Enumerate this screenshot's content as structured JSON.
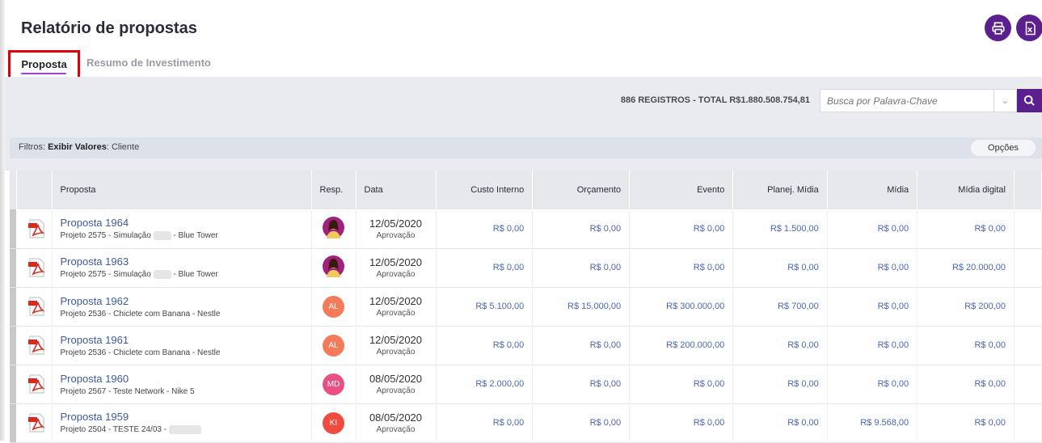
{
  "page": {
    "title": "Relatório de propostas",
    "print_icon": "printer-icon",
    "excel_icon": "excel-icon"
  },
  "tabs": [
    {
      "label": "Proposta",
      "active": true
    },
    {
      "label": "Resumo de Investimento",
      "active": false
    }
  ],
  "summary": {
    "records": "886 REGISTROS - TOTAL R$1.880.508.754,81"
  },
  "search": {
    "placeholder": "Busca por Palavra-Chave"
  },
  "filters": {
    "prefix": "Filtros:",
    "label": "Exibir Valores",
    "value": ": Cliente",
    "options_button": "Opções"
  },
  "table": {
    "headers": [
      "Proposta",
      "Resp.",
      "Data",
      "Custo Interno",
      "Orçamento",
      "Evento",
      "Planej. Mídia",
      "Mídia",
      "Mídia digital"
    ],
    "rows": [
      {
        "name": "Proposta 1964",
        "sub_a": "Projeto 2575 - Simulação",
        "sub_b": "- Blue Tower",
        "avatar": "",
        "avatar_color": "#a0227a",
        "date": "12/05/2020",
        "status": "Aprovação",
        "values": [
          "R$ 0,00",
          "R$ 0,00",
          "R$ 0,00",
          "R$ 1.500,00",
          "R$ 0,00",
          "R$ 0,00"
        ]
      },
      {
        "name": "Proposta 1963",
        "sub_a": "Projeto 2575 - Simulação",
        "sub_b": "- Blue Tower",
        "avatar": "",
        "avatar_color": "#a0227a",
        "date": "12/05/2020",
        "status": "Aprovação",
        "values": [
          "R$ 0,00",
          "R$ 0,00",
          "R$ 0,00",
          "R$ 0,00",
          "R$ 0,00",
          "R$ 20.000,00"
        ]
      },
      {
        "name": "Proposta 1962",
        "sub_a": "Projeto 2536 - Chiclete com Banana - Nestle",
        "sub_b": "",
        "avatar": "AL",
        "avatar_color": "#f47a5a",
        "date": "12/05/2020",
        "status": "Aprovação",
        "values": [
          "R$ 5.100,00",
          "R$ 15.000,00",
          "R$ 300.000,00",
          "R$ 700,00",
          "R$ 0,00",
          "R$ 200,00"
        ]
      },
      {
        "name": "Proposta 1961",
        "sub_a": "Projeto 2536 - Chiclete com Banana - Nestle",
        "sub_b": "",
        "avatar": "AL",
        "avatar_color": "#f47a5a",
        "date": "12/05/2020",
        "status": "Aprovação",
        "values": [
          "R$ 0,00",
          "R$ 0,00",
          "R$ 200.000,00",
          "R$ 0,00",
          "R$ 0,00",
          "R$ 0,00"
        ]
      },
      {
        "name": "Proposta 1960",
        "sub_a": "Projeto 2567 - Teste Network - Nike 5",
        "sub_b": "",
        "avatar": "MD",
        "avatar_color": "#e94f82",
        "date": "08/05/2020",
        "status": "Aprovação",
        "values": [
          "R$ 2.000,00",
          "R$ 0,00",
          "R$ 0,00",
          "R$ 0,00",
          "R$ 0,00",
          "R$ 0,00"
        ]
      },
      {
        "name": "Proposta 1959",
        "sub_a": "Projeto 2504 - TESTE 24/03 -",
        "sub_b": "",
        "avatar": "KI",
        "avatar_color": "#ef4b3f",
        "date": "08/05/2020",
        "status": "Aprovação",
        "values": [
          "R$ 0,00",
          "R$ 0,00",
          "R$ 0,00",
          "R$ 0,00",
          "R$ 9.568,00",
          "R$ 0,00"
        ]
      }
    ]
  }
}
